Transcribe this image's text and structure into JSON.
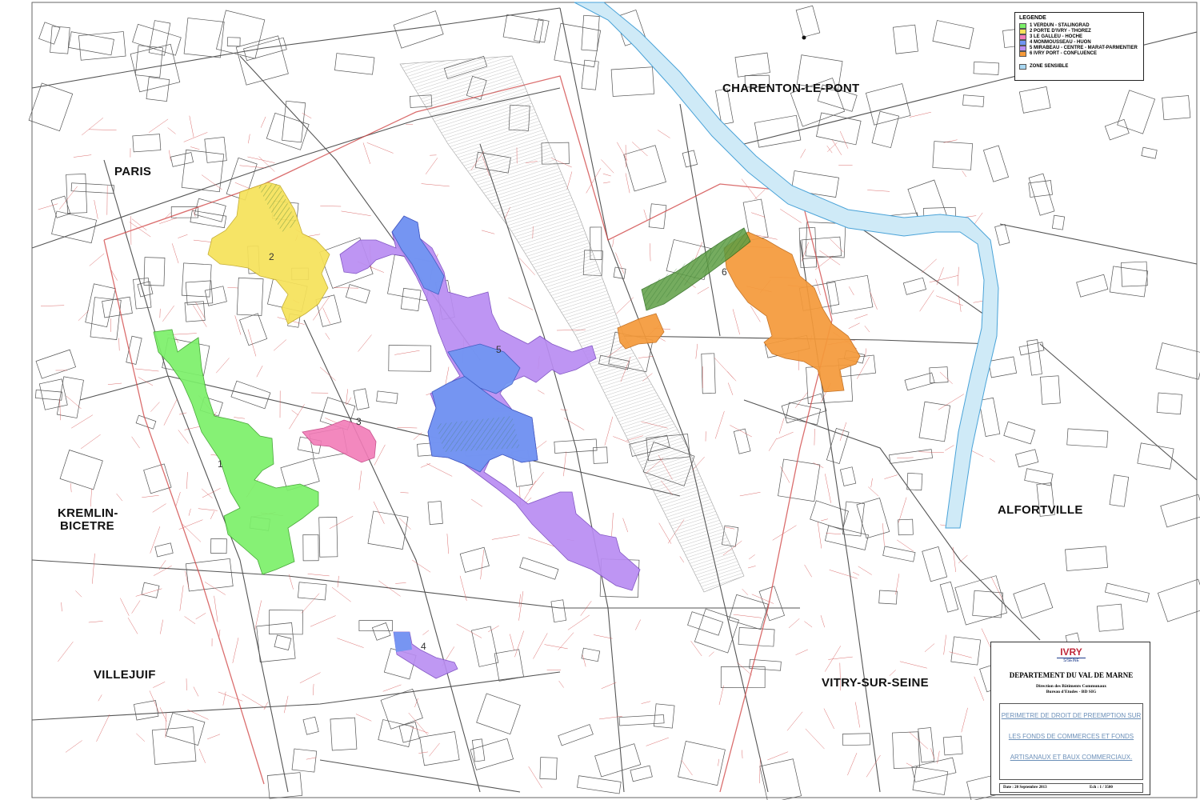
{
  "cities": {
    "paris": "PARIS",
    "charenton": "CHARENTON-LE-PONT",
    "kremlin": [
      "KREMLIN-",
      "BICETRE"
    ],
    "alfortville": "ALFORTVILLE",
    "villejuif": "VILLEJUIF",
    "vitry": "VITRY-SUR-SEINE"
  },
  "legend": {
    "title": "LEGENDE",
    "items": [
      {
        "label": "1  VERDUN - STALINGRAD",
        "color": "#7cf06a"
      },
      {
        "label": "2  PORTE D'IVRY  -  THOREZ",
        "color": "#f6e25a"
      },
      {
        "label": "3  LE GALLEU  -  HOCHE",
        "color": "#f27cb8"
      },
      {
        "label": "4  MONMOUSSEAU  -  HUON",
        "color": "#6f95f2"
      },
      {
        "label": "5  MIRABEAU  -  CENTRE  -  MARAT-PARMENTIER",
        "color": "#b98df2"
      },
      {
        "label": "6  IVRY PORT  -  CONFLUENCE",
        "color": "#f59a3a"
      }
    ],
    "zone_label": "ZONE SENSIBLE",
    "zone_color": "#a9d8f2"
  },
  "zone_numbers": [
    "1",
    "2",
    "3",
    "4",
    "5",
    "6"
  ],
  "cartouche": {
    "logo_top": "IVRY",
    "logo_bottom": "S/SEINE",
    "department": "DEPARTEMENT DU VAL DE MARNE",
    "direction_line1": "Direction des Bâtiments Communaux",
    "direction_line2": "Bureau d'Etudes  -  BD SIG",
    "title_line1": "PERIMETRE DE DROIT DE PREEMPTION SUR",
    "title_line2": "LES FONDS DE COMMERCES ET FONDS",
    "title_line3": "ARTISANAUX ET BAUX COMMERCIAUX.",
    "date": "Date : 20 Septembre 2013",
    "scale": "Ech :    1  /  3500"
  },
  "colors": {
    "river": "#cfeaf7",
    "river_edge": "#4aa3d8",
    "parcel_lines": "#d24a4a",
    "street_lines": "#555555"
  }
}
